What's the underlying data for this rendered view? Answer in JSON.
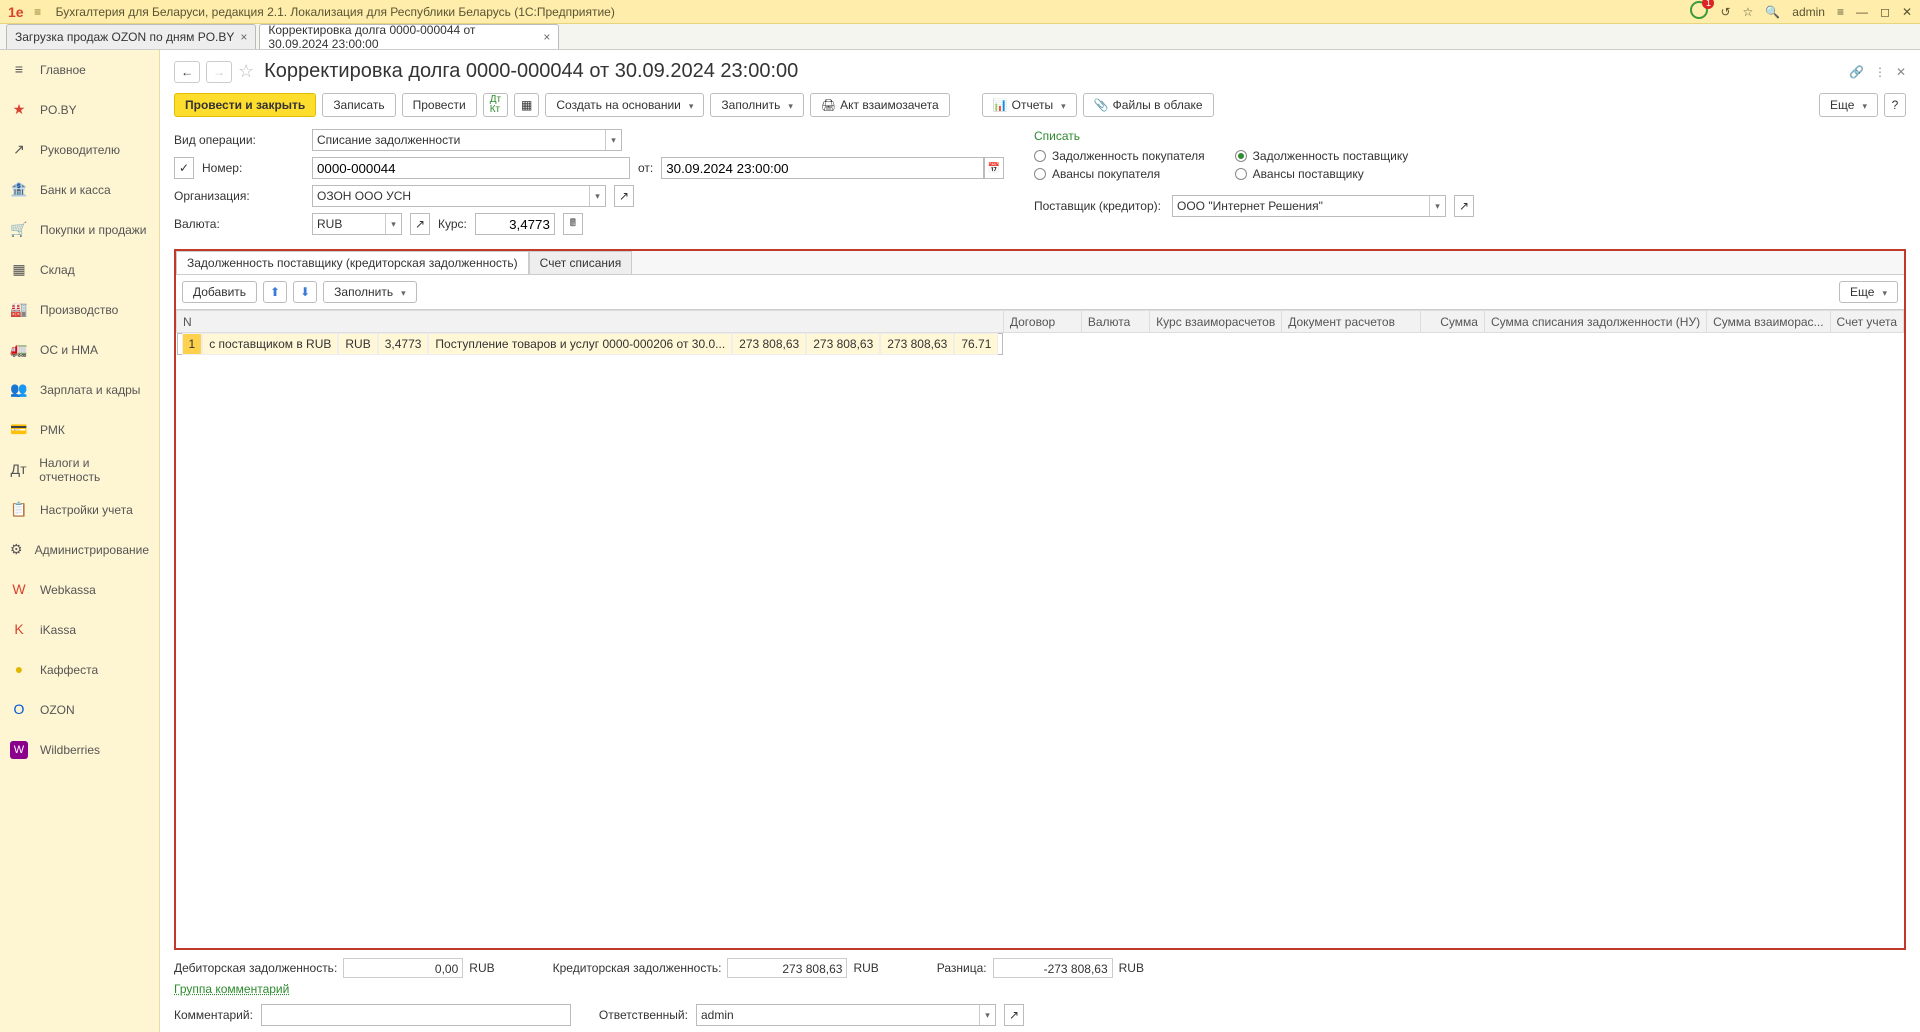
{
  "titlebar": {
    "app_title": "Бухгалтерия для Беларуси, редакция 2.1. Локализация для Республики Беларусь   (1С:Предприятие)",
    "user": "admin",
    "notif_count": "1"
  },
  "doctabs": [
    {
      "label": "Загрузка продаж OZON по дням PO.BY"
    },
    {
      "label": "Корректировка долга 0000-000044 от 30.09.2024 23:00:00"
    }
  ],
  "sidebar": [
    {
      "icon": "≡",
      "label": "Главное"
    },
    {
      "icon": "★",
      "label": "PO.BY"
    },
    {
      "icon": "↗",
      "label": "Руководителю"
    },
    {
      "icon": "🏦",
      "label": "Банк и касса"
    },
    {
      "icon": "🛒",
      "label": "Покупки и продажи"
    },
    {
      "icon": "▦",
      "label": "Склад"
    },
    {
      "icon": "🏭",
      "label": "Производство"
    },
    {
      "icon": "🚛",
      "label": "ОС и НМА"
    },
    {
      "icon": "👥",
      "label": "Зарплата и кадры"
    },
    {
      "icon": "💳",
      "label": "РМК"
    },
    {
      "icon": "Дт",
      "label": "Налоги и отчетность"
    },
    {
      "icon": "📋",
      "label": "Настройки учета"
    },
    {
      "icon": "⚙",
      "label": "Администрирование"
    },
    {
      "icon": "W",
      "label": "Webkassa"
    },
    {
      "icon": "K",
      "label": "iKassa"
    },
    {
      "icon": "●",
      "label": "Каффеста"
    },
    {
      "icon": "O",
      "label": "OZON"
    },
    {
      "icon": "W",
      "label": "Wildberries"
    }
  ],
  "doc": {
    "title": "Корректировка долга 0000-000044 от 30.09.2024 23:00:00",
    "toolbar": {
      "post_close": "Провести и закрыть",
      "write": "Записать",
      "post": "Провести",
      "create_based": "Создать на основании",
      "fill": "Заполнить",
      "act": "Акт взаимозачета",
      "reports": "Отчеты",
      "files": "Файлы в облаке",
      "more": "Еще"
    },
    "labels": {
      "oper_type": "Вид операции:",
      "number": "Номер:",
      "date_from": "от:",
      "org": "Организация:",
      "currency": "Валюта:",
      "rate": "Курс:",
      "write_off": "Списать",
      "opt1": "Задолженность покупателя",
      "opt2": "Задолженность поставщику",
      "opt3": "Авансы покупателя",
      "opt4": "Авансы поставщику",
      "supplier": "Поставщик (кредитор):"
    },
    "fields": {
      "oper_type": "Списание задолженности",
      "number": "0000-000044",
      "date": "30.09.2024 23:00:00",
      "org": "ОЗОН ООО УСН",
      "currency": "RUB",
      "rate": "3,4773",
      "supplier": "ООО \"Интернет Решения\""
    },
    "tabs": {
      "t1": "Задолженность поставщику (кредиторская задолженность)",
      "t2": "Счет списания",
      "add": "Добавить",
      "fill": "Заполнить",
      "more": "Еще"
    },
    "grid": {
      "cols": {
        "n": "N",
        "contract": "Договор",
        "currency": "Валюта",
        "rate": "Курс взаиморасчетов",
        "doc": "Документ расчетов",
        "sum": "Сумма",
        "sum_nu": "Сумма списания задолженности (НУ)",
        "sum_mutual": "Сумма взаиморас...",
        "account": "Счет учета"
      },
      "rows": [
        {
          "n": "1",
          "contract": "с поставщиком в RUB",
          "currency": "RUB",
          "rate": "3,4773",
          "doc": "Поступление товаров и услуг 0000-000206 от 30.0...",
          "sum": "273 808,63",
          "sum_nu": "273 808,63",
          "sum_mutual": "273 808,63",
          "account": "76.71"
        }
      ]
    },
    "footer": {
      "deb_label": "Дебиторская задолженность:",
      "deb_value": "0,00",
      "deb_cur": "RUB",
      "cred_label": "Кредиторская задолженность:",
      "cred_value": "273 808,63",
      "cred_cur": "RUB",
      "diff_label": "Разница:",
      "diff_value": "-273 808,63",
      "diff_cur": "RUB",
      "group_comment": "Группа комментарий",
      "comment_label": "Комментарий:",
      "resp_label": "Ответственный:",
      "resp_value": "admin"
    }
  }
}
